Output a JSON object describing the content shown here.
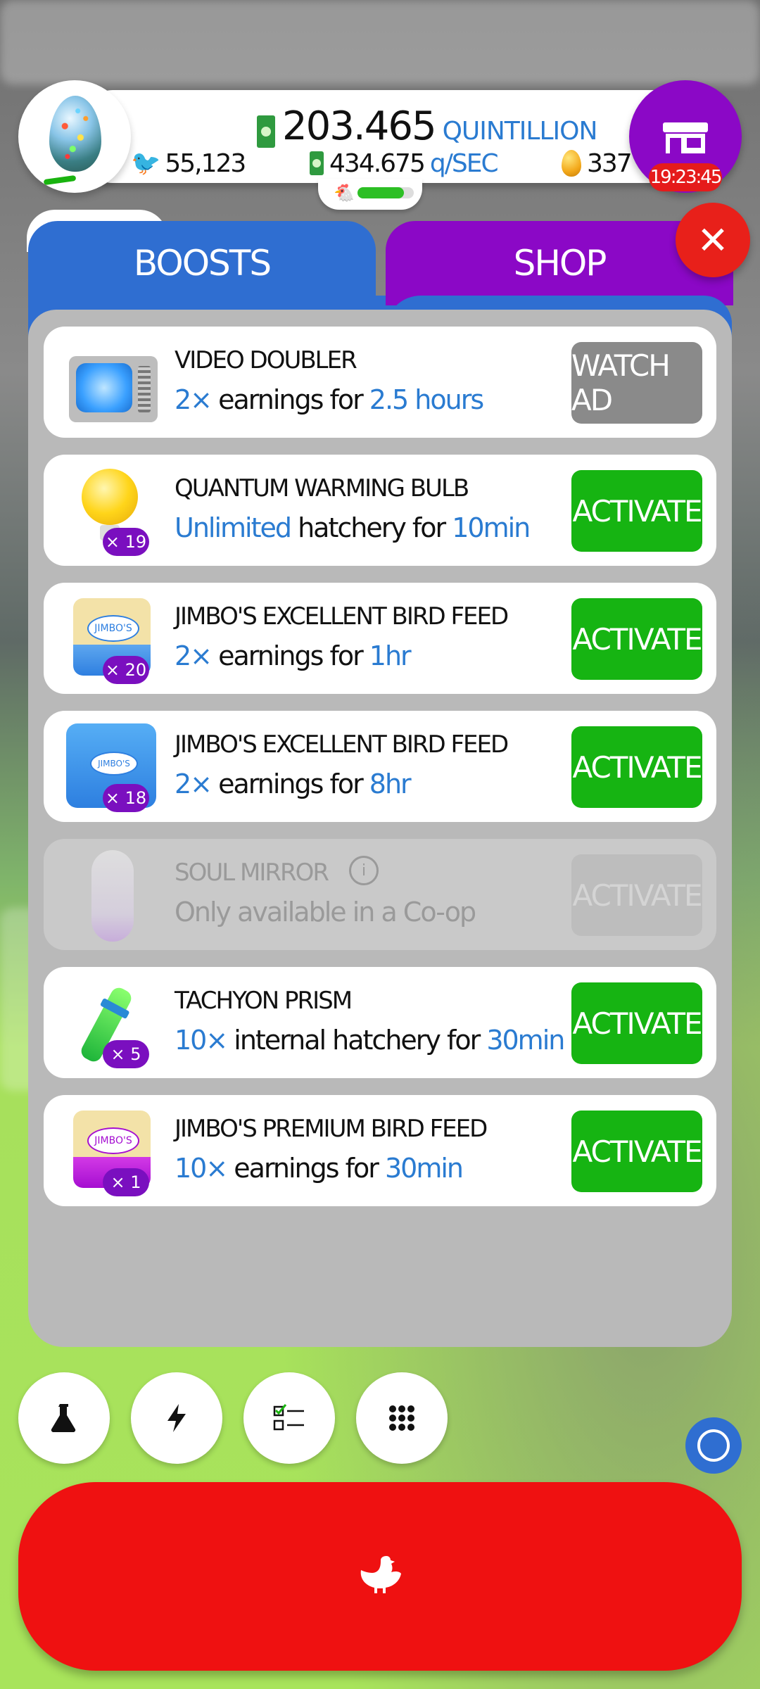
{
  "header": {
    "money_value": "203.465",
    "money_unit": "QUINTILLION",
    "chickens": "55,123",
    "rate_value": "434.675",
    "rate_unit": "q/SEC",
    "golden_eggs": "337",
    "shop_timer": "19:23:45",
    "hab_fill_fraction": 0.82
  },
  "tabs": {
    "boosts": "BOOSTS",
    "shop": "SHOP"
  },
  "boosts": [
    {
      "name": "VIDEO DOUBLER",
      "desc_a": "2×",
      "desc_b": " earnings",
      "desc_c": " for ",
      "desc_d": "2.5 hours",
      "button": "WATCH AD",
      "icon": "tv-icon"
    },
    {
      "name": "QUANTUM WARMING BULB",
      "desc_a": "Unlimited",
      "desc_b": " hatchery",
      "desc_c": " for ",
      "desc_d": "10min",
      "button": "ACTIVATE",
      "count": "× 19",
      "icon": "bulb-icon"
    },
    {
      "name": "JIMBO'S EXCELLENT BIRD FEED",
      "desc_a": "2×",
      "desc_b": " earnings",
      "desc_c": " for ",
      "desc_d": "1hr",
      "button": "ACTIVATE",
      "count": "× 20",
      "icon": "feed-bag-icon"
    },
    {
      "name": "JIMBO'S EXCELLENT BIRD FEED",
      "desc_a": "2×",
      "desc_b": " earnings",
      "desc_c": " for ",
      "desc_d": "8hr",
      "button": "ACTIVATE",
      "count": "× 18",
      "icon": "feed-stack-icon"
    },
    {
      "name": "SOUL MIRROR",
      "desc_full": "Only available in a Co-op",
      "button": "ACTIVATE",
      "icon": "soul-mirror-icon"
    },
    {
      "name": "TACHYON PRISM",
      "desc_a": "10×",
      "desc_b": " internal hatchery",
      "desc_c": " for ",
      "desc_d": "30min",
      "button": "ACTIVATE",
      "count": "× 5",
      "icon": "prism-icon"
    },
    {
      "name": "JIMBO'S PREMIUM BIRD FEED",
      "desc_a": "10×",
      "desc_b": " earnings",
      "desc_c": " for ",
      "desc_d": "30min",
      "button": "ACTIVATE",
      "count": "× 1",
      "icon": "premium-feed-icon"
    }
  ],
  "bag_label": "JIMBO'S",
  "colors": {
    "accent_blue": "#2f6ed1",
    "shop_purple": "#8b08c6",
    "activate_green": "#16b412",
    "danger_red": "#ef1111"
  },
  "toolbar": {
    "research_icon": "flask-icon",
    "boost_icon": "lightning-icon",
    "missions_icon": "checklist-icon",
    "menu_icon": "grid-icon"
  }
}
